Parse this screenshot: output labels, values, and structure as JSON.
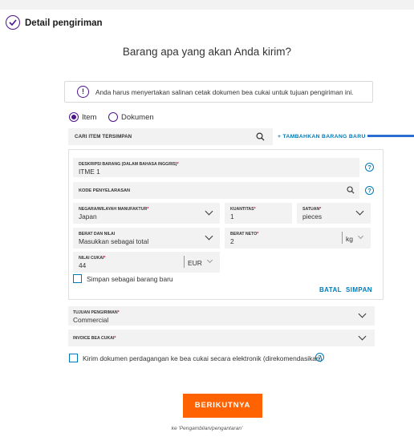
{
  "header": {
    "title": "Detail pengiriman",
    "icon": "check-circle-icon",
    "accent": "#4d148c"
  },
  "question": "Barang apa yang akan Anda kirim?",
  "notice": {
    "text": "Anda harus menyertakan salinan cetak dokumen bea cukai untuk tujuan pengiriman ini.",
    "icon": "info-icon"
  },
  "shipment_type": {
    "options": [
      "Item",
      "Dokumen"
    ],
    "selected": "Item"
  },
  "search": {
    "label": "CARI ITEM TERSIMPAN",
    "icon": "search-icon",
    "add_link": "+ TAMBAHKAN BARANG BARU"
  },
  "item_form": {
    "description": {
      "label": "DESKRIPSI BARANG (DALAM BAHASA INGGRIS)",
      "required": "*",
      "value": "ITME 1"
    },
    "harmonized_code": {
      "label": "KODE PENYELARASAN"
    },
    "country": {
      "label": "NEGARA/WILAYAH MANUFAKTUR",
      "required": "*",
      "value": "Japan"
    },
    "quantity": {
      "label": "KUANTITAS",
      "required": "*",
      "value": "1"
    },
    "unit": {
      "label": "SATUAN",
      "required": "*",
      "value": "pieces"
    },
    "weight_value": {
      "label": "BERAT DAN NILAI",
      "value": "Masukkan sebagai total"
    },
    "net_weight": {
      "label": "BERAT NETO",
      "required": "*",
      "value": "2",
      "unit": "kg"
    },
    "customs_value": {
      "label": "NILAI CUKAI",
      "required": "*",
      "value": "44",
      "currency": "EUR"
    },
    "save_checkbox": "Simpan sebagai barang baru",
    "cancel": "BATAL",
    "save": "SIMPAN"
  },
  "destination_purpose": {
    "label": "TUJUAN PENGIRIMAN",
    "required": "*",
    "value": "Commercial"
  },
  "customs_invoice": {
    "label": "INVOICE BEA CUKAI",
    "required": "*"
  },
  "electronic_docs": {
    "label": "Kirim dokumen perdagangan ke bea cukai secara elektronik (direkomendasikan)"
  },
  "next_button": "BERIKUTNYA",
  "footer_hint": "ke 'Pengambilan/pengantaran'",
  "colors": {
    "primary": "#4d148c",
    "link": "#007ab7",
    "cta": "#ff6200",
    "required": "#de002e"
  }
}
